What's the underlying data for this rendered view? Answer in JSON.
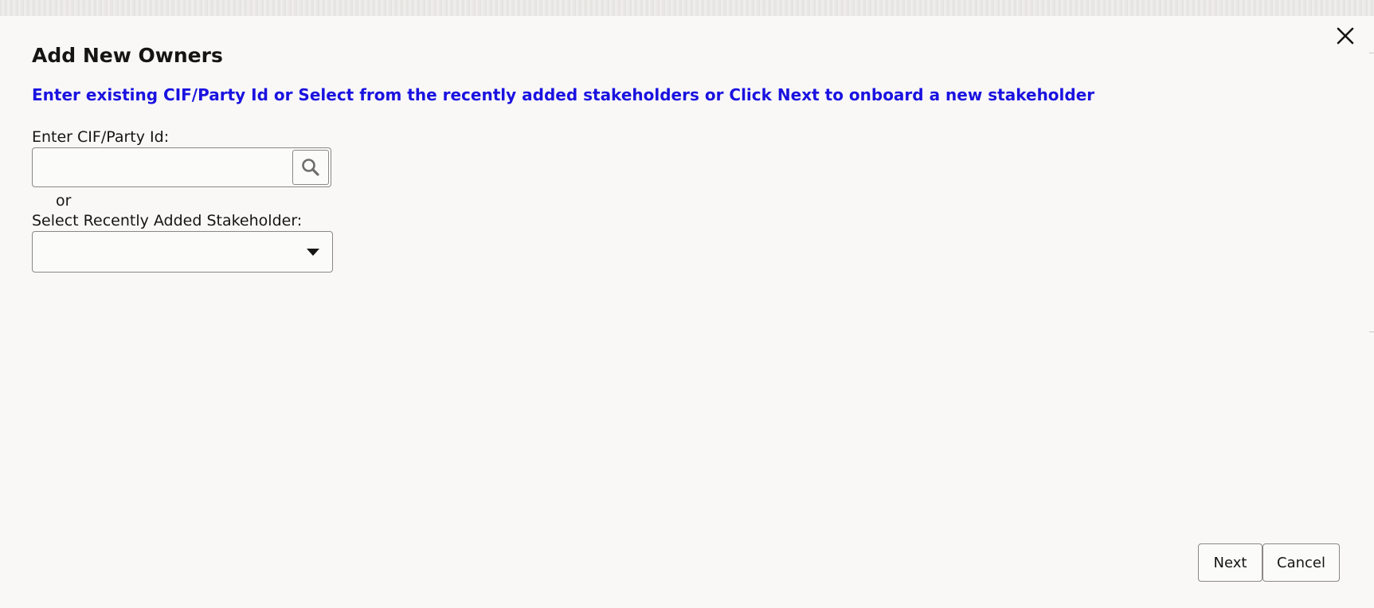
{
  "dialog": {
    "title": "Add New Owners",
    "instruction": "Enter existing CIF/Party Id or Select from the recently added stakeholders or Click Next to onboard a new stakeholder",
    "close_icon": "close-icon"
  },
  "cif": {
    "label": "Enter CIF/Party Id:",
    "value": "",
    "placeholder": "",
    "search_icon": "search-icon"
  },
  "separator_text": "or",
  "stakeholder": {
    "label": "Select Recently Added Stakeholder:",
    "selected": "",
    "dropdown_icon": "caret-down-icon"
  },
  "footer": {
    "next_label": "Next",
    "cancel_label": "Cancel"
  },
  "colors": {
    "background": "#f9f8f7",
    "instruction_text": "#1a12e0",
    "text": "#161513",
    "border": "#8a8885"
  }
}
